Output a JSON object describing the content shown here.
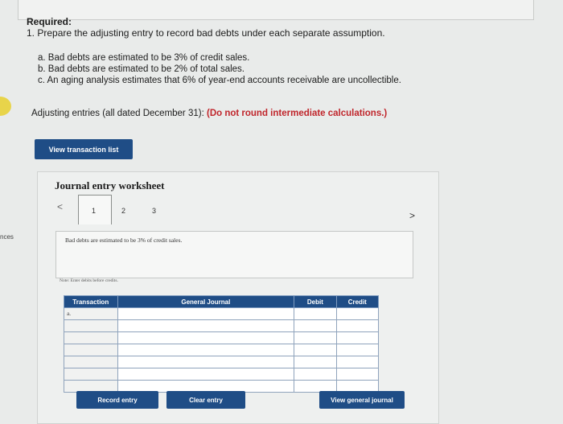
{
  "required": {
    "title": "Required:",
    "line": "1. Prepare the adjusting entry to record bad debts under each separate assumption.",
    "assumptions": [
      "a. Bad debts are estimated to be 3% of credit sales.",
      "b. Bad debts are estimated to be 2% of total sales.",
      "c. An aging analysis estimates that 6% of year-end accounts receivable are uncollectible."
    ]
  },
  "adjusting": {
    "text": "Adjusting entries (all dated December 31): ",
    "warning": "(Do not round intermediate calculations.)"
  },
  "side_label": "nces",
  "view_button": "View transaction list",
  "worksheet": {
    "title": "Journal entry worksheet",
    "tabs": [
      "1",
      "2",
      "3"
    ],
    "description": "Bad debts are estimated to be 3% of credit sales.",
    "note": "Note: Enter debits before credits.",
    "table": {
      "headers": [
        "Transaction",
        "General Journal",
        "Debit",
        "Credit"
      ],
      "first_transaction": "a."
    },
    "buttons": {
      "record": "Record entry",
      "clear": "Clear entry",
      "view_journal": "View general journal"
    }
  },
  "colors": {
    "button": "#1f4d86",
    "warning": "#c0262c"
  }
}
